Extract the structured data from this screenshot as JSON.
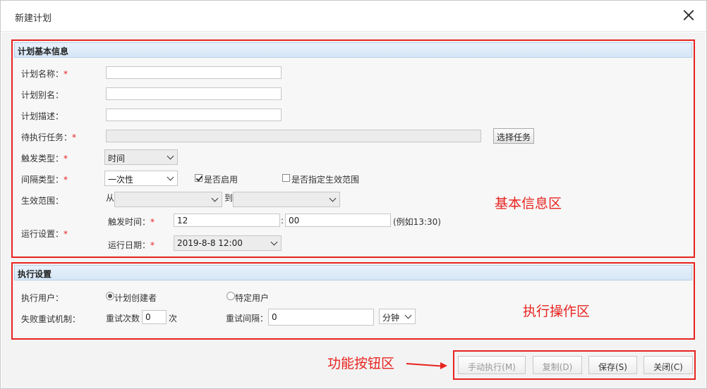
{
  "dialog": {
    "title": "新建计划"
  },
  "basic": {
    "header": "计划基本信息",
    "plan_name_label": "计划名称：",
    "plan_alias_label": "计划别名：",
    "plan_desc_label": "计划描述：",
    "pending_task_label": "待执行任务：",
    "select_task_button": "选择任务",
    "trigger_type_label": "触发类型：",
    "trigger_type_value": "时间",
    "interval_type_label": "间隔类型：",
    "interval_type_value": "一次性",
    "enabled_label": "是否启用",
    "enabled_checked": true,
    "specify_range_label": "是否指定生效范围",
    "specify_range_checked": false,
    "effective_range_label": "生效范围：",
    "from_label": "从",
    "to_label": "到",
    "run_settings_label": "运行设置：",
    "trigger_time_label": "触发时间：",
    "trigger_hour": "12",
    "time_sep": ":",
    "trigger_minute": "00",
    "time_example": "(例如13:30)",
    "run_date_label": "运行日期：",
    "run_date_value": "2019-8-8 12:00",
    "required_mark": "*"
  },
  "exec": {
    "header": "执行设置",
    "exec_user_label": "执行用户：",
    "opt_creator": "计划创建者",
    "opt_specific": "特定用户",
    "selected": "creator",
    "retry_label": "失败重试机制：",
    "retry_count_label": "重试次数",
    "retry_count_value": "0",
    "retry_count_unit": "次",
    "retry_interval_label": "重试间隔：",
    "retry_interval_value": "0",
    "retry_interval_unit": "分钟"
  },
  "footer": {
    "manual_run": "手动执行(M)",
    "copy": "复制(D)",
    "save": "保存(S)",
    "close": "关闭(C)"
  },
  "annotations": {
    "basic_area": "基本信息区",
    "exec_area": "执行操作区",
    "button_area": "功能按钮区"
  },
  "colors": {
    "annotation": "#e8231f",
    "section_header": "#d6e6f6"
  }
}
